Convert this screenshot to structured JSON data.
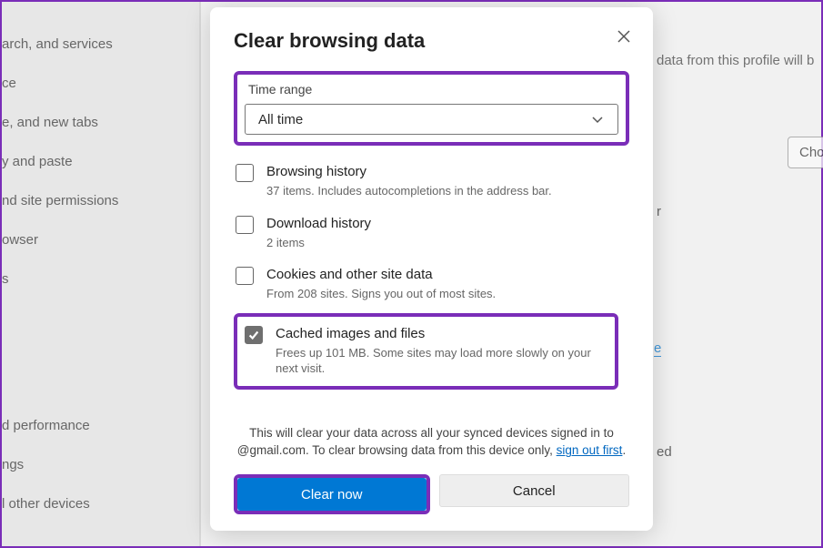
{
  "nav": {
    "items": [
      "arch, and services",
      "ce",
      "e, and new tabs",
      "y and paste",
      "nd site permissions",
      "owser",
      "s",
      "",
      "",
      "",
      "d performance",
      "ngs",
      "l other devices"
    ]
  },
  "bg_fragments": {
    "top_right": "data from this profile will b",
    "choose_btn": "Cho",
    "r2": "r",
    "r3": "e",
    "r4": "ed",
    "bottom_heading": ""
  },
  "dialog": {
    "title": "Clear browsing data",
    "time_range_label": "Time range",
    "time_range_value": "All time",
    "items": [
      {
        "title": "Browsing history",
        "desc": "37 items. Includes autocompletions in the address bar.",
        "checked": false
      },
      {
        "title": "Download history",
        "desc": "2 items",
        "checked": false
      },
      {
        "title": "Cookies and other site data",
        "desc": "From 208 sites. Signs you out of most sites.",
        "checked": false
      },
      {
        "title": "Cached images and files",
        "desc": "Frees up 101 MB. Some sites may load more slowly on your next visit.",
        "checked": true
      }
    ],
    "note_pre": "This will clear your data across all your synced devices signed in to ",
    "note_email": "@gmail.com. To clear browsing data from this device only, ",
    "note_link": "sign out first",
    "note_post": ".",
    "clear_btn": "Clear now",
    "cancel_btn": "Cancel"
  }
}
